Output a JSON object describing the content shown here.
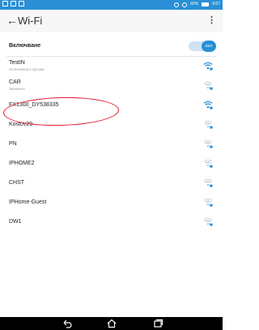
{
  "status_bar": {
    "time": "9:07",
    "battery_percent": "92%"
  },
  "app_bar": {
    "title": "Wi-Fi",
    "back_icon": "arrow-back-icon",
    "menu_icon": "more-vert-icon"
  },
  "wifi_toggle": {
    "label": "Включване",
    "state": "ВКЛ",
    "on": true
  },
  "networks": [
    {
      "name": "TestIN",
      "status": "Установена е връзка",
      "connected": true
    },
    {
      "name": "CAR",
      "status": "Запазено",
      "connected": false
    },
    {
      "name": "FX1300_DY538335",
      "status": "",
      "connected": false,
      "highlighted": true
    },
    {
      "name": "Kostov29",
      "status": "",
      "connected": false
    },
    {
      "name": "PN",
      "status": "",
      "connected": false
    },
    {
      "name": "IPHOME2",
      "status": "",
      "connected": false
    },
    {
      "name": "CHST",
      "status": "",
      "connected": false
    },
    {
      "name": "IPHome-Guest",
      "status": "",
      "connected": false
    },
    {
      "name": "DW1",
      "status": "",
      "connected": false
    }
  ],
  "colors": {
    "accent": "#2a8fd6",
    "annotation": "#e2142b"
  },
  "nav_bar": {
    "icons": [
      "back-nav-icon",
      "home-icon",
      "recents-icon"
    ]
  }
}
